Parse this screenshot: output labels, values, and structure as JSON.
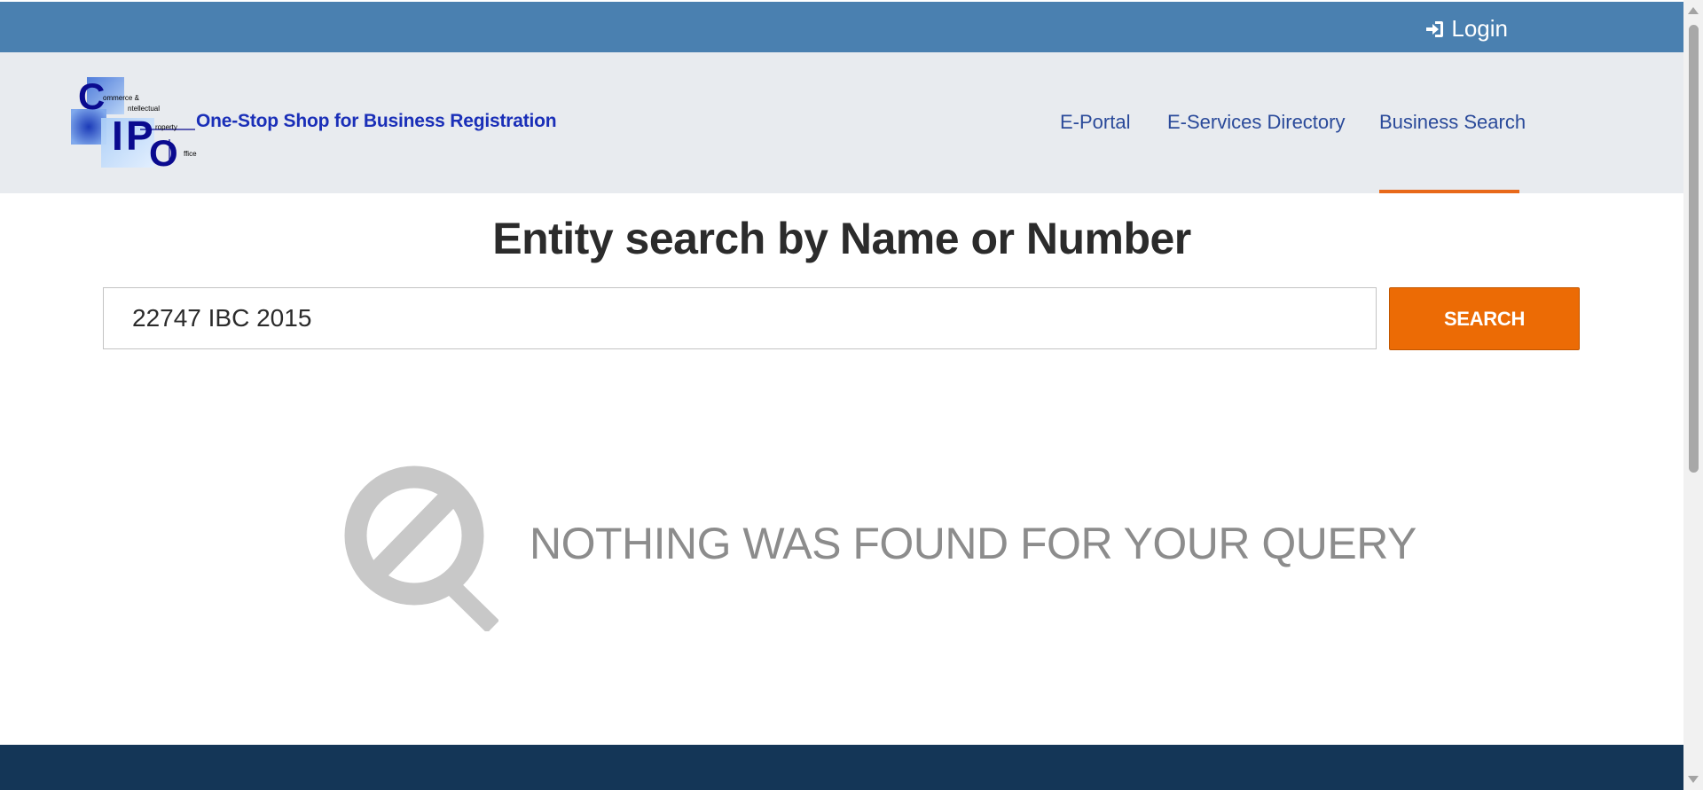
{
  "topbar": {
    "login_label": "Login",
    "login_icon": "sign-in-icon",
    "background": "#4a80b0"
  },
  "header": {
    "logo": {
      "letters": [
        "C",
        "I",
        "P",
        "O"
      ],
      "words": [
        "ommerce &",
        "ntellectual",
        "roperty",
        "ffice"
      ]
    },
    "tagline": "One-Stop Shop for Business Registration",
    "nav": [
      {
        "label": "E-Portal"
      },
      {
        "label": "E-Services Directory"
      },
      {
        "label": "Business Search",
        "active": true
      }
    ],
    "active_color": "#e8691a"
  },
  "search": {
    "heading": "Entity search by Name or Number",
    "query": "22747 IBC 2015",
    "button_label": "SEARCH",
    "button_color": "#ec6b05"
  },
  "results": {
    "empty_icon": "no-results-magnifier-icon",
    "empty_message": "NOTHING WAS FOUND FOR YOUR QUERY"
  },
  "footer": {
    "background": "#143657"
  }
}
